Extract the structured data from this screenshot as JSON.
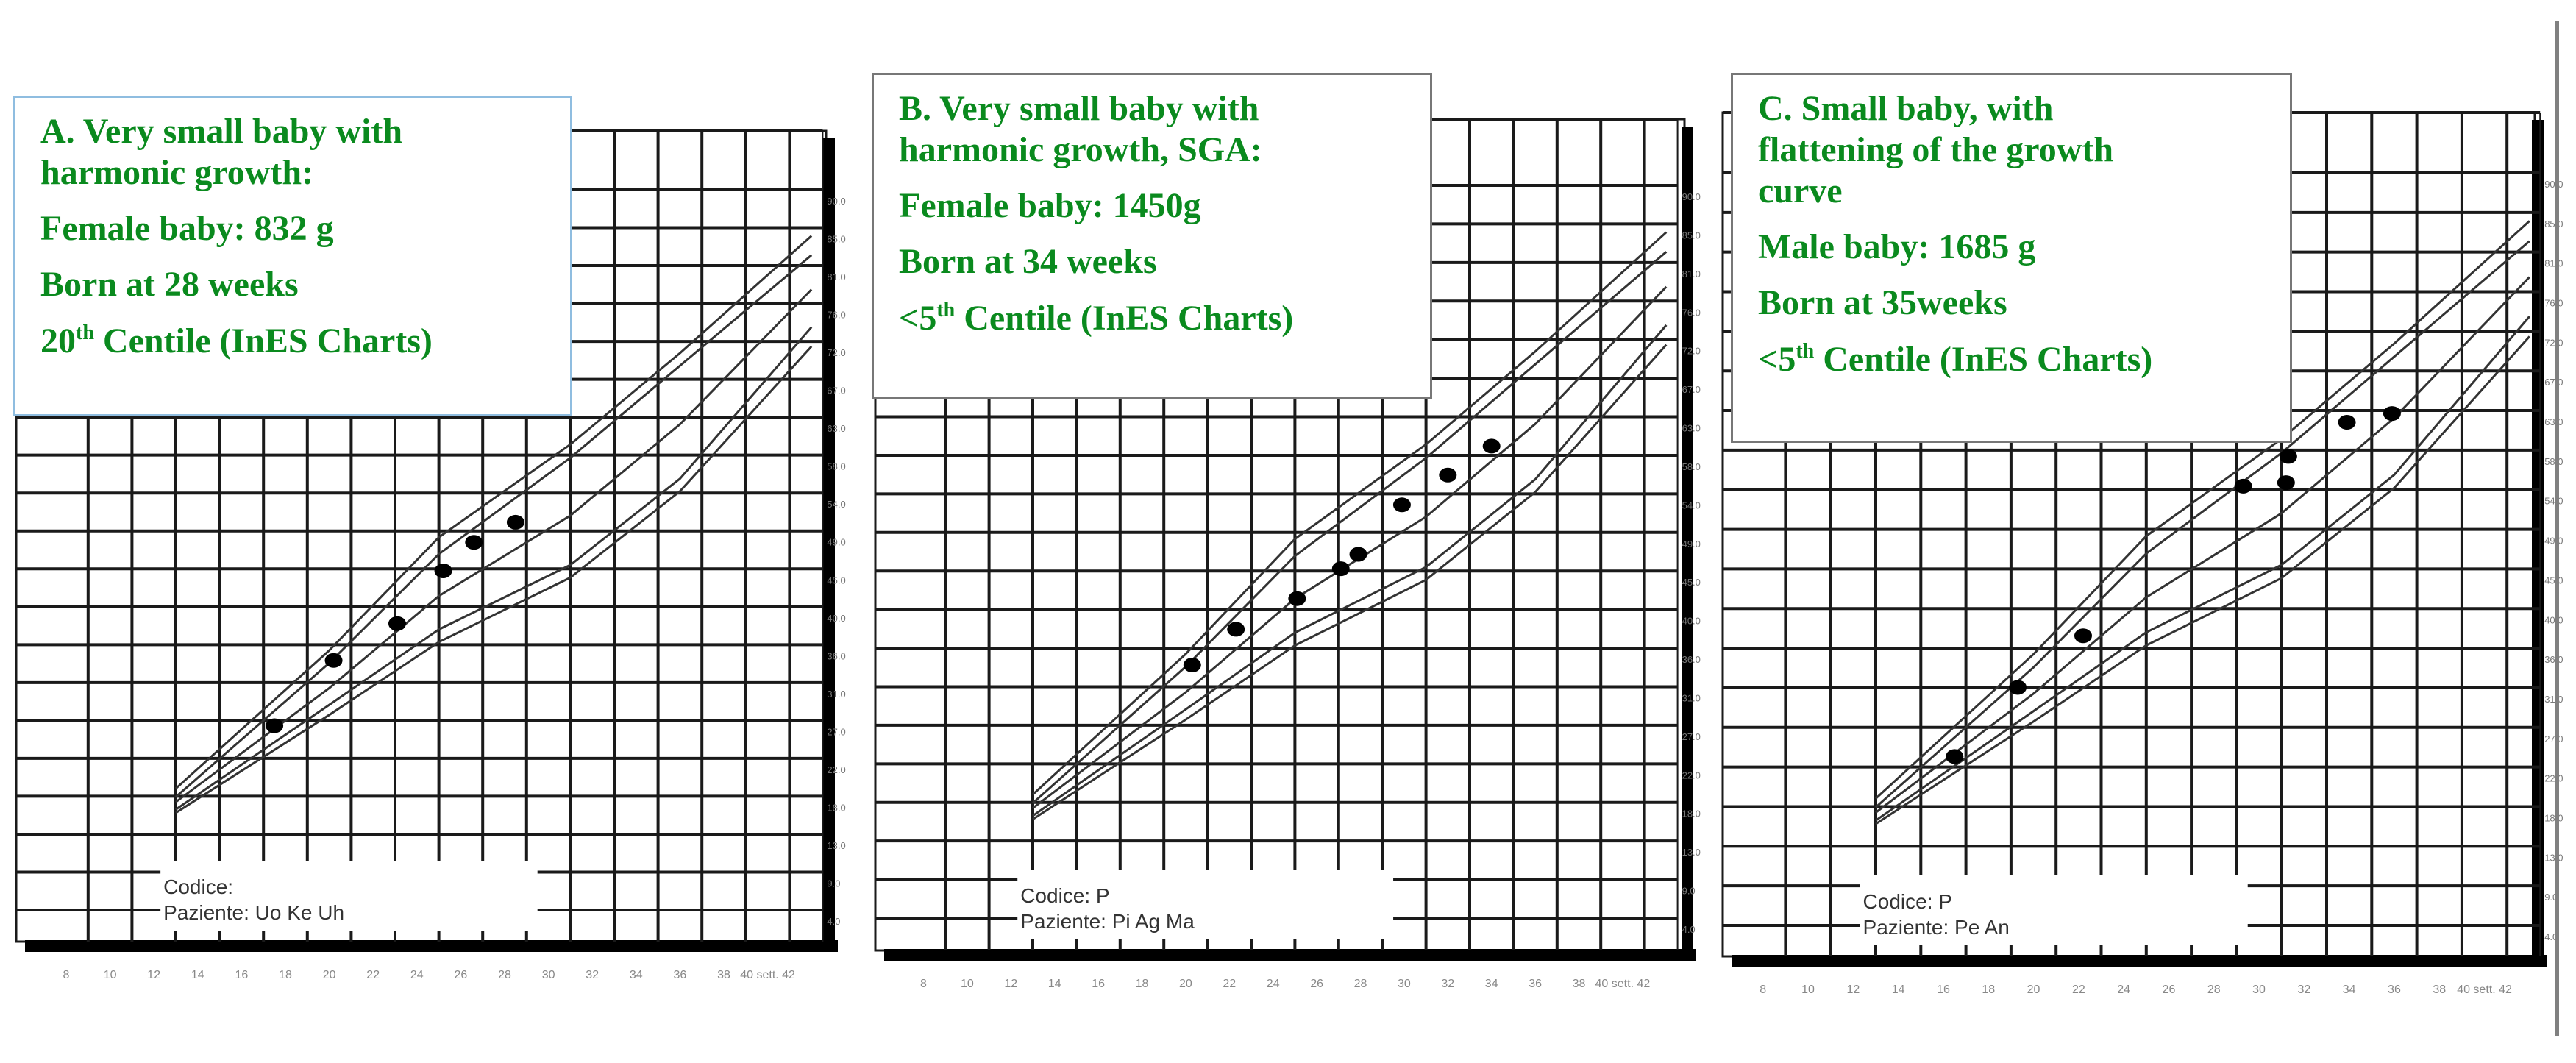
{
  "figure": {
    "panels": [
      {
        "id": "A",
        "info": {
          "title_lines": [
            "A. Very small baby with",
            "harmonic growth:"
          ],
          "sex_weight": "Female baby: 832 g",
          "born": "Born at 28 weeks",
          "centile_prefix": "20",
          "centile_sup": "th",
          "centile_suffix": " Centile (InES Charts)"
        },
        "patient": {
          "codice_label": "Codice:",
          "codice_value": "",
          "paziente_label": "Paziente:",
          "paziente_value": "Uo   Ke   Uh"
        }
      },
      {
        "id": "B",
        "info": {
          "title_lines": [
            "B. Very small baby with",
            "harmonic growth, SGA:"
          ],
          "sex_weight": "Female baby: 1450g",
          "born": "Born at 34 weeks",
          "centile_prefix": "<5",
          "centile_sup": "th",
          "centile_suffix": " Centile (InES Charts)"
        },
        "patient": {
          "codice_label": "Codice:",
          "codice_value": "P",
          "paziente_label": "Paziente:",
          "paziente_value": "Pi      Ag    Ma"
        }
      },
      {
        "id": "C",
        "info": {
          "title_lines": [
            "C. Small baby, with",
            "flattening of the growth",
            "curve"
          ],
          "sex_weight": "Male baby: 1685 g",
          "born": "Born at 35weeks",
          "centile_prefix": "<5",
          "centile_sup": "th",
          "centile_suffix": " Centile (InES Charts)"
        },
        "patient": {
          "codice_label": "Codice:",
          "codice_value": "P",
          "paziente_label": "Paziente:",
          "paziente_value": "Pe     An"
        }
      }
    ],
    "colors": {
      "text_green": "#0a8a1e",
      "box_a_border": "#8fbde0",
      "grid": "#1a1a1a",
      "curve": "#333333",
      "point": "#000000"
    }
  },
  "chart_data": [
    {
      "type": "scatter",
      "title": "A. Very small baby with harmonic growth",
      "xlabel": "sett.",
      "ylabel": "",
      "xlim": [
        8,
        42
      ],
      "ylim": [
        4.0,
        90.0
      ],
      "x_tick_labels": [
        "8",
        "10",
        "12",
        "14",
        "16",
        "18",
        "20",
        "22",
        "24",
        "26",
        "28",
        "30",
        "32",
        "34",
        "36",
        "38",
        "40 sett. 42"
      ],
      "y_tick_labels": [
        "4.0",
        "9.0",
        "13.0",
        "18.0",
        "22.0",
        "27.0",
        "31.0",
        "36.0",
        "40.0",
        "45.0",
        "49.0",
        "54.0",
        "58.0",
        "63.0",
        "67.0",
        "72.0",
        "76.0",
        "81.0",
        "85.0",
        "90.0"
      ],
      "grid": true,
      "centile_curves": [
        {
          "name": "upper-1",
          "x": [
            13,
            20,
            25,
            31,
            36,
            42
          ],
          "y": [
            18.5,
            35.0,
            48.5,
            59.6,
            70.5,
            84.5
          ]
        },
        {
          "name": "upper-2",
          "x": [
            13,
            20,
            25,
            31,
            36,
            42
          ],
          "y": [
            17.5,
            33.5,
            46.5,
            58.0,
            69.0,
            82.2
          ]
        },
        {
          "name": "median",
          "x": [
            13,
            20,
            25,
            31,
            36,
            42
          ],
          "y": [
            16.9,
            30.5,
            41.5,
            51.1,
            62.0,
            78.1
          ]
        },
        {
          "name": "lower-1",
          "x": [
            13,
            20,
            25,
            31,
            36,
            42
          ],
          "y": [
            16.0,
            28.5,
            37.5,
            45.2,
            55.5,
            73.6
          ]
        },
        {
          "name": "lower-2",
          "x": [
            13,
            20,
            25,
            31,
            36,
            42
          ],
          "y": [
            15.6,
            27.3,
            36.0,
            43.7,
            54.0,
            71.3
          ]
        }
      ],
      "series": [
        {
          "name": "patient measurements",
          "x": [
            17.5,
            20.2,
            23.1,
            25.2,
            26.6,
            28.5
          ],
          "y": [
            26.0,
            33.8,
            38.2,
            44.5,
            47.9,
            50.3
          ]
        }
      ]
    },
    {
      "type": "scatter",
      "title": "B. Very small baby with harmonic growth, SGA",
      "xlabel": "sett.",
      "ylabel": "",
      "xlim": [
        8,
        42
      ],
      "ylim": [
        4.0,
        90.0
      ],
      "x_tick_labels": [
        "8",
        "10",
        "12",
        "14",
        "16",
        "18",
        "20",
        "22",
        "24",
        "26",
        "28",
        "30",
        "32",
        "34",
        "36",
        "38",
        "40 sett. 42"
      ],
      "y_tick_labels": [
        "4.0",
        "9.0",
        "13.0",
        "18.0",
        "22.0",
        "27.0",
        "31.0",
        "36.0",
        "40.0",
        "45.0",
        "49.0",
        "54.0",
        "58.0",
        "63.0",
        "67.0",
        "72.0",
        "76.0",
        "81.0",
        "85.0",
        "90.0"
      ],
      "grid": true,
      "centile_curves": [
        {
          "name": "upper-1",
          "x": [
            13,
            20,
            25,
            31,
            36,
            42
          ],
          "y": [
            18.5,
            35.0,
            48.5,
            59.6,
            70.5,
            84.5
          ]
        },
        {
          "name": "upper-2",
          "x": [
            13,
            20,
            25,
            31,
            36,
            42
          ],
          "y": [
            17.5,
            33.5,
            46.5,
            58.0,
            69.0,
            82.2
          ]
        },
        {
          "name": "median",
          "x": [
            13,
            20,
            25,
            31,
            36,
            42
          ],
          "y": [
            16.9,
            30.5,
            41.5,
            51.1,
            62.0,
            78.1
          ]
        },
        {
          "name": "lower-1",
          "x": [
            13,
            20,
            25,
            31,
            36,
            42
          ],
          "y": [
            16.0,
            28.5,
            37.5,
            45.2,
            55.5,
            73.6
          ]
        },
        {
          "name": "lower-2",
          "x": [
            13,
            20,
            25,
            31,
            36,
            42
          ],
          "y": [
            15.6,
            27.3,
            36.0,
            43.7,
            54.0,
            71.3
          ]
        }
      ],
      "series": [
        {
          "name": "patient measurements",
          "x": [
            20.3,
            22.3,
            25.1,
            27.1,
            27.9,
            29.9,
            32.0,
            34.0
          ],
          "y": [
            33.7,
            37.9,
            41.5,
            45.0,
            46.7,
            52.5,
            56.0,
            59.4
          ]
        }
      ]
    },
    {
      "type": "scatter",
      "title": "C. Small baby, with flattening of the growth curve",
      "xlabel": "sett.",
      "ylabel": "",
      "xlim": [
        8,
        42
      ],
      "ylim": [
        4.0,
        90.0
      ],
      "x_tick_labels": [
        "8",
        "10",
        "12",
        "14",
        "16",
        "18",
        "20",
        "22",
        "24",
        "26",
        "28",
        "30",
        "32",
        "34",
        "36",
        "38",
        "40 sett. 42"
      ],
      "y_tick_labels": [
        "4.0",
        "9.0",
        "13.0",
        "18.0",
        "22.0",
        "27.0",
        "31.0",
        "36.0",
        "40.0",
        "45.0",
        "49.0",
        "54.0",
        "58.0",
        "63.0",
        "67.0",
        "72.0",
        "76.0",
        "81.0",
        "85.0",
        "90.0"
      ],
      "grid": true,
      "centile_curves": [
        {
          "name": "upper-1",
          "x": [
            13,
            20,
            25,
            31,
            36,
            42
          ],
          "y": [
            18.5,
            35.0,
            48.5,
            59.6,
            70.5,
            84.5
          ]
        },
        {
          "name": "upper-2",
          "x": [
            13,
            20,
            25,
            31,
            36,
            42
          ],
          "y": [
            17.5,
            33.5,
            46.5,
            58.0,
            69.0,
            82.2
          ]
        },
        {
          "name": "median",
          "x": [
            13,
            20,
            25,
            31,
            36,
            42
          ],
          "y": [
            16.9,
            30.5,
            41.5,
            51.1,
            62.0,
            78.1
          ]
        },
        {
          "name": "lower-1",
          "x": [
            13,
            20,
            25,
            31,
            36,
            42
          ],
          "y": [
            16.0,
            28.5,
            37.5,
            45.2,
            55.5,
            73.6
          ]
        },
        {
          "name": "lower-2",
          "x": [
            13,
            20,
            25,
            31,
            36,
            42
          ],
          "y": [
            15.6,
            27.3,
            36.0,
            43.7,
            54.0,
            71.3
          ]
        }
      ],
      "series": [
        {
          "name": "patient measurements",
          "x": [
            16.5,
            19.3,
            22.2,
            29.3,
            31.3,
            31.2,
            33.9,
            35.9
          ],
          "y": [
            23.3,
            31.2,
            37.1,
            54.2,
            57.6,
            54.6,
            61.5,
            62.5
          ]
        }
      ]
    }
  ]
}
